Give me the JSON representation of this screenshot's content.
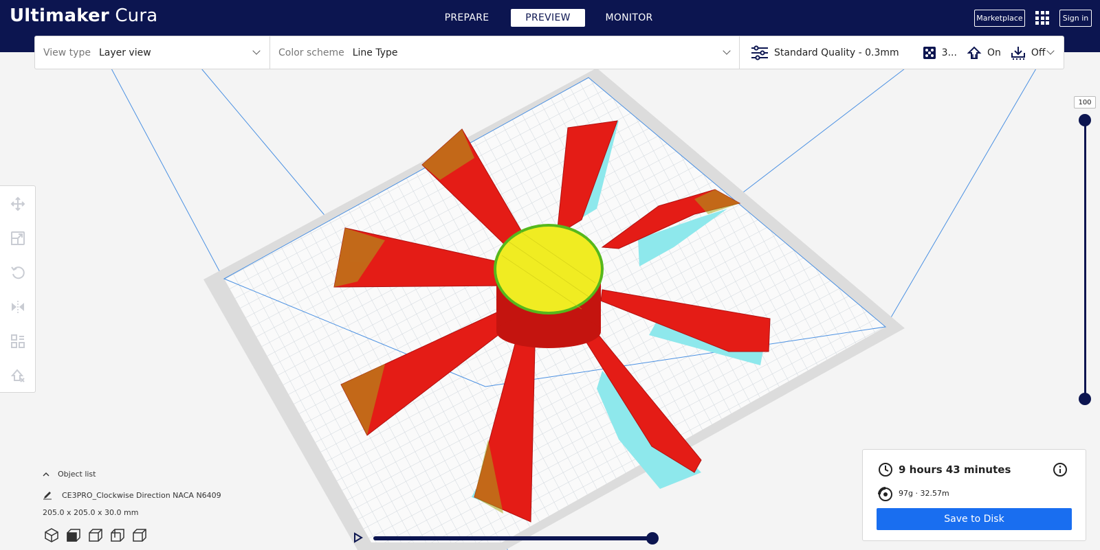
{
  "app": {
    "brand_bold": "Ultimaker",
    "brand_light": " Cura"
  },
  "stages": [
    {
      "label": "PREPARE",
      "active": false
    },
    {
      "label": "PREVIEW",
      "active": true
    },
    {
      "label": "MONITOR",
      "active": false
    }
  ],
  "header": {
    "marketplace_label": "Marketplace",
    "signin_label": "Sign in"
  },
  "toolbar": {
    "view_type_label": "View type",
    "view_type_value": "Layer view",
    "color_scheme_label": "Color scheme",
    "color_scheme_value": "Line Type",
    "quality": "Standard Quality - 0.3mm",
    "infill": "3...",
    "support": "On",
    "adhesion": "Off"
  },
  "left_tools": [
    "move-icon",
    "scale-icon",
    "rotate-icon",
    "mirror-icon",
    "per-model-settings-icon",
    "support-blocker-icon"
  ],
  "layer_slider": {
    "value": "100"
  },
  "object_list": {
    "toggle_label": "Object list",
    "object_name": "CE3PRO_Clockwise Direction NACA N6409",
    "dimensions": "205.0 x 205.0 x 30.0 mm"
  },
  "print_info": {
    "time": "9 hours 43 minutes",
    "material": "97g · 32.57m",
    "save_label": "Save to Disk"
  },
  "colors": {
    "header_bg": "#0c1550",
    "accent": "#196ef0",
    "wall_red": "#e41c16",
    "skin_yellow": "#f0ec22",
    "support_cyan": "#8ee8ec"
  }
}
